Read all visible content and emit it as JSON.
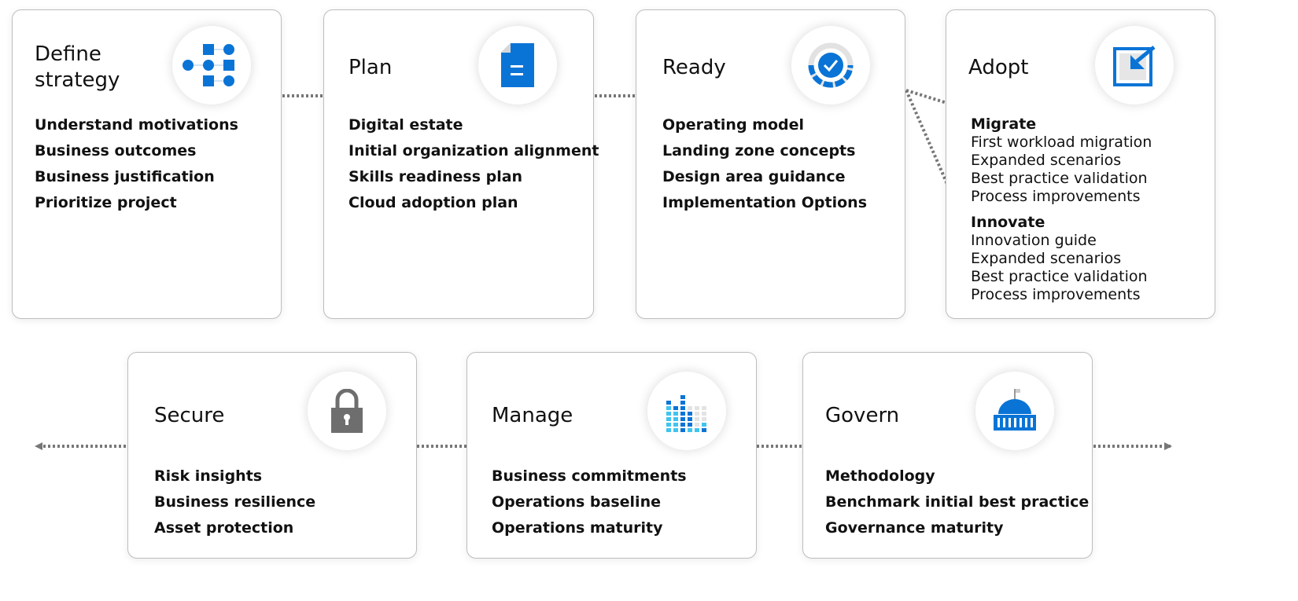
{
  "colors": {
    "accent": "#0a74d6",
    "light_accent": "#40c4f0",
    "gray_icon": "#6e6e6e",
    "arrow": "#777777"
  },
  "top": [
    {
      "title": "Define strategy",
      "icon": "process-flow-icon",
      "items": [
        "Understand motivations",
        "Business outcomes",
        "Business justification",
        "Prioritize project"
      ]
    },
    {
      "title": "Plan",
      "icon": "document-icon",
      "items": [
        "Digital estate",
        "Initial organization alignment",
        "Skills readiness plan",
        "Cloud adoption plan"
      ]
    },
    {
      "title": "Ready",
      "icon": "checkmark-gear-icon",
      "items": [
        "Operating model",
        "Landing zone concepts",
        "Design area guidance",
        "Implementation Options"
      ]
    },
    {
      "title": "Adopt",
      "icon": "migrate-arrow-icon",
      "migrate": {
        "heading": "Migrate",
        "items": [
          "First workload migration",
          "Expanded scenarios",
          "Best practice validation",
          "Process improvements"
        ]
      },
      "innovate": {
        "heading": "Innovate",
        "items": [
          "Innovation guide",
          "Expanded scenarios",
          "Best practice validation",
          "Process improvements"
        ]
      }
    }
  ],
  "bottom": [
    {
      "title": "Secure",
      "icon": "lock-icon",
      "items": [
        "Risk insights",
        "Business resilience",
        "Asset protection"
      ]
    },
    {
      "title": "Manage",
      "icon": "bar-chart-icon",
      "items": [
        "Business commitments",
        "Operations baseline",
        "Operations maturity"
      ]
    },
    {
      "title": "Govern",
      "icon": "capitol-building-icon",
      "items": [
        "Methodology",
        "Benchmark initial best practice",
        "Governance maturity"
      ]
    }
  ]
}
